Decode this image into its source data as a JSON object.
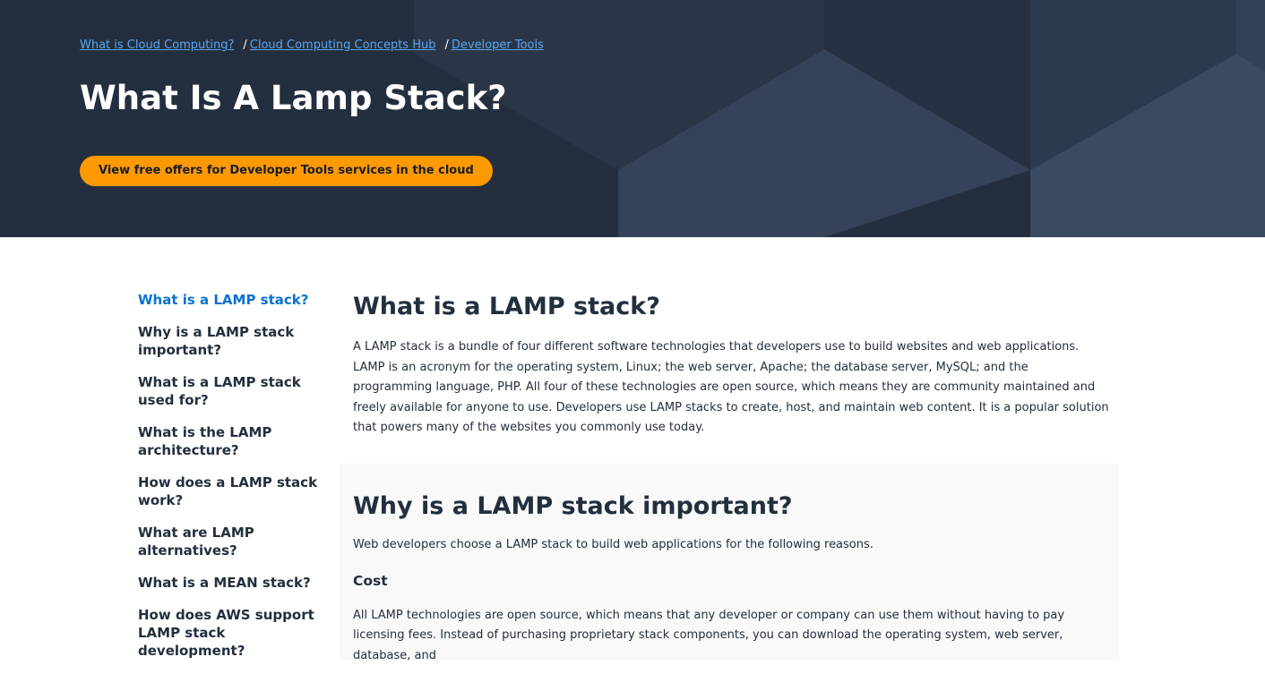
{
  "breadcrumb": {
    "items": [
      {
        "label": "What is Cloud Computing?"
      },
      {
        "label": "Cloud Computing Concepts Hub"
      },
      {
        "label": "Developer Tools"
      }
    ],
    "separator": "/"
  },
  "hero": {
    "title": "What Is A Lamp Stack?",
    "cta_label": "View free offers for Developer Tools services in the cloud"
  },
  "toc": {
    "items": [
      {
        "label": "What is a LAMP stack?",
        "active": true
      },
      {
        "label": "Why is a LAMP stack important?",
        "active": false
      },
      {
        "label": "What is a LAMP stack used for?",
        "active": false
      },
      {
        "label": "What is the LAMP architecture?",
        "active": false
      },
      {
        "label": "How does a LAMP stack work?",
        "active": false
      },
      {
        "label": "What are LAMP alternatives?",
        "active": false
      },
      {
        "label": "What is a MEAN stack?",
        "active": false
      },
      {
        "label": "How does AWS support LAMP stack development?",
        "active": false
      }
    ]
  },
  "sections": {
    "intro": {
      "title": "What is a LAMP stack?",
      "body": "A LAMP stack is a bundle of four different software technologies that developers use to build websites and web applications. LAMP is an acronym for the operating system, Linux; the web server, Apache; the database server, MySQL; and the programming language, PHP. All four of these technologies are open source, which means they are community maintained and freely available for anyone to use. Developers use LAMP stacks to create, host, and maintain web content. It is a popular solution that powers many of the websites you commonly use today."
    },
    "importance": {
      "title": "Why is a LAMP stack important?",
      "intro": "Web developers choose a LAMP stack to build web applications for the following reasons.",
      "subheading": "Cost",
      "body": "All LAMP technologies are open source, which means that any developer or company can use them without having to pay licensing fees. Instead of purchasing proprietary stack components, you can download the operating system, web server, database, and"
    }
  },
  "colors": {
    "hero_bg": "#232f3e",
    "link": "#5ba6f5",
    "cta": "#ff9900",
    "toc_active": "#0972d3",
    "text": "#232f3e"
  }
}
